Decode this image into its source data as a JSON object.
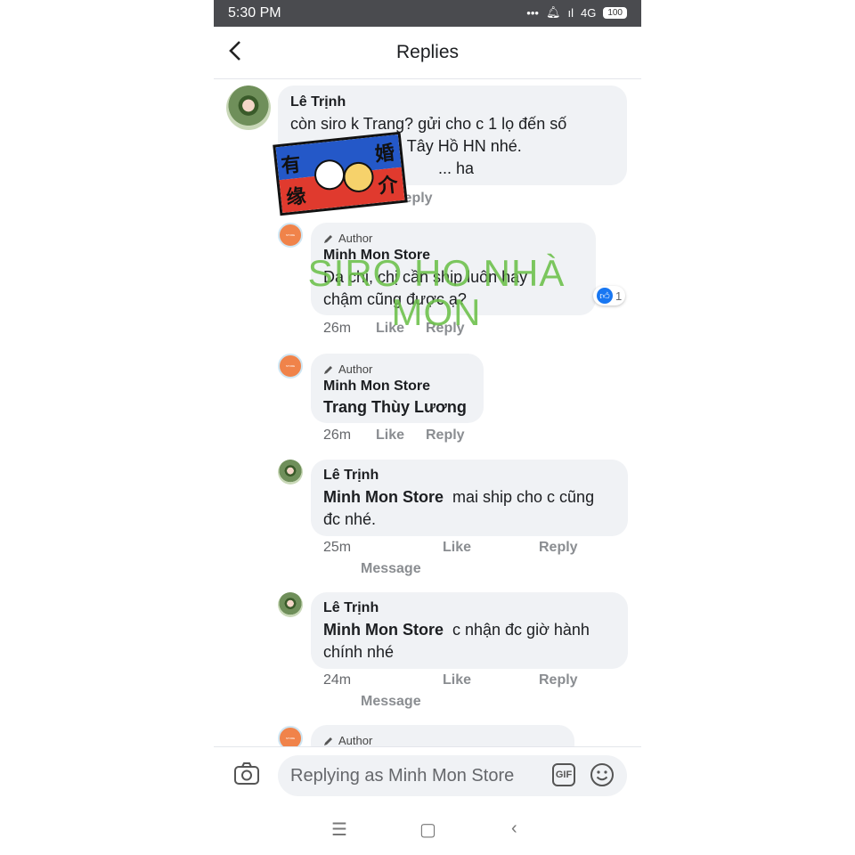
{
  "status_bar": {
    "time": "5:30 PM",
    "network": "4G",
    "battery": "100"
  },
  "header": {
    "title": "Replies"
  },
  "comments": [
    {
      "name": "Lê Trịnh",
      "lines": [
        "còn siro k Trang? gửi cho c 1 lọ đến số",
        "30 ... u, Tây Hồ HN nhé.",
        "... ha"
      ],
      "actions": {
        "reply": "Reply"
      }
    },
    {
      "author_badge": "Author",
      "name": "Minh Mon Store",
      "lines": [
        "Dạ chị, chị cần ship luôn hay",
        "chậm cũng được ạ?"
      ],
      "reaction_count": "1",
      "actions": {
        "time": "26m",
        "like": "Like",
        "reply": "Reply"
      }
    },
    {
      "author_badge": "Author",
      "name": "Minh Mon Store",
      "tag": "Trang Thùy Lương",
      "actions": {
        "time": "26m",
        "like": "Like",
        "reply": "Reply"
      }
    },
    {
      "name": "Lê Trịnh",
      "tag": "Minh Mon Store",
      "first_line": "mai ship cho c cũng",
      "second_line": "đc nhé.",
      "actions": {
        "time": "25m",
        "like": "Like",
        "reply": "Reply",
        "message": "Message"
      }
    },
    {
      "name": "Lê Trịnh",
      "tag": "Minh Mon Store",
      "first_line": "c nhận đc giờ hành",
      "second_line": "chính nhé",
      "actions": {
        "time": "24m",
        "like": "Like",
        "reply": "Reply",
        "message": "Message"
      }
    },
    {
      "author_badge": "Author"
    }
  ],
  "watermark": {
    "line1": "SIRO HO NHÀ",
    "line2": "MON"
  },
  "sticker": {
    "chars": [
      "有",
      "婚",
      "缘",
      "介"
    ]
  },
  "composer": {
    "placeholder": "Replying as Minh Mon Store",
    "gif_label": "GIF"
  },
  "icons": {
    "back": "chevron-left-icon",
    "camera": "camera-icon",
    "gif": "gif-icon",
    "emoji": "smiley-icon",
    "pencil": "pencil-icon",
    "like": "thumbs-up-icon"
  },
  "colors": {
    "bubble": "#f0f2f5",
    "like_blue": "#1877f2",
    "watermark": "#6cc04a",
    "store_avatar": "#f0834a"
  }
}
